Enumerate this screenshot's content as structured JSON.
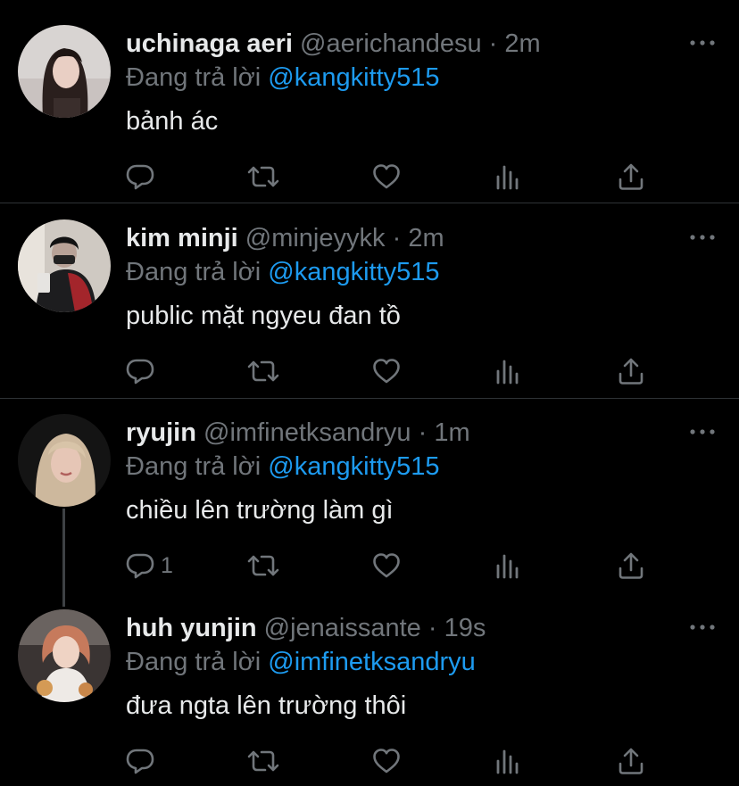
{
  "reply_prefix": "Đang trả lời",
  "tweets": [
    {
      "name": "uchinaga aeri",
      "handle": "@aerichandesu",
      "separator": "·",
      "time": "2m",
      "reply_to": "@kangkitty515",
      "text": "bảnh ác",
      "reply_count": ""
    },
    {
      "name": "kim minji",
      "handle": "@minjeyykk",
      "separator": "·",
      "time": "2m",
      "reply_to": "@kangkitty515",
      "text": "public mặt ngyeu đan tồ",
      "reply_count": ""
    },
    {
      "name": "ryujin",
      "handle": "@imfinetksandryu",
      "separator": "·",
      "time": "1m",
      "reply_to": "@kangkitty515",
      "text": "chiều lên trường làm gì",
      "reply_count": "1"
    },
    {
      "name": "huh yunjin",
      "handle": "@jenaissante",
      "separator": "·",
      "time": "19s",
      "reply_to": "@imfinetksandryu",
      "text": "đưa ngta lên trường thôi",
      "reply_count": ""
    }
  ],
  "icons": {
    "reply": "reply-icon",
    "retweet": "retweet-icon",
    "like": "heart-icon",
    "views": "views-icon",
    "share": "share-icon",
    "more": "more-icon"
  },
  "colors": {
    "background": "#000000",
    "text": "#e7e9ea",
    "muted": "#71767b",
    "link": "#1d9bf0",
    "divider": "#2f3336"
  }
}
